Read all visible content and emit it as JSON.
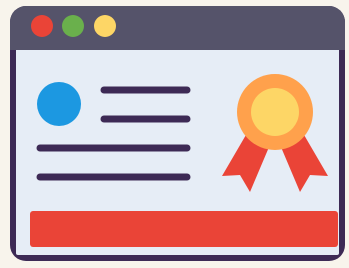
{
  "illustration": {
    "background": "#f8f4ec",
    "window": {
      "frame_color": "#3d2a55",
      "titlebar_color": "#55536a",
      "content_color": "#e6edf6",
      "traffic_lights": {
        "red": "#ea4437",
        "green": "#6ab04c",
        "yellow": "#fdd666"
      }
    },
    "profile_icon": "avatar-circle",
    "avatar_color": "#1c98e1",
    "text_line_color": "#3d2a55",
    "certificate_badge": {
      "icon": "award-ribbon-icon",
      "outer_color": "#ffa14c",
      "inner_color": "#fdd666",
      "ribbon_color": "#ea4437"
    },
    "action_bar_color": "#ea4437"
  }
}
